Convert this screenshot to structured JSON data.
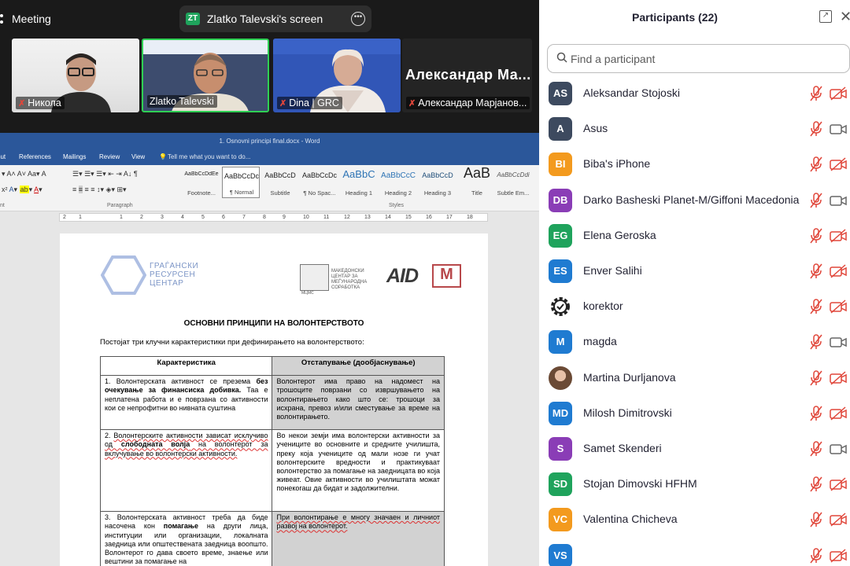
{
  "meeting": {
    "label": "Meeting"
  },
  "share": {
    "badge": "ZT",
    "title": "Zlatko Talevski's screen",
    "badge_color": "#1fa35c"
  },
  "videos": [
    {
      "name": "Никола",
      "muted": true
    },
    {
      "name": "Zlatko Talevski",
      "muted": false,
      "active_border": "#2fd054"
    },
    {
      "name": "Dina | GRC",
      "muted": true
    },
    {
      "name": "Александар Марјанов...",
      "muted": true,
      "big_label": "Александар  Ма..."
    }
  ],
  "word": {
    "title": "1. Osnovni principi final.docx - Word",
    "tabs": [
      "out",
      "References",
      "Mailings",
      "Review",
      "View"
    ],
    "tell_me": "Tell me what you want to do...",
    "styles": [
      {
        "sample": "AaBbCcDdEe",
        "name": "Footnote..."
      },
      {
        "sample": "AaBbCcDc",
        "name": "¶ Normal"
      },
      {
        "sample": "AaBbCcD",
        "name": "Subtitle"
      },
      {
        "sample": "AaBbCcDc",
        "name": "¶ No Spac..."
      },
      {
        "sample": "AaBbC",
        "name": "Heading 1"
      },
      {
        "sample": "AaBbCcC",
        "name": "Heading 2"
      },
      {
        "sample": "AaBbCcD",
        "name": "Heading 3"
      },
      {
        "sample": "AaB",
        "name": "Title"
      },
      {
        "sample": "AaBbCcDdi",
        "name": "Subtle Em..."
      }
    ],
    "group_labels": {
      "font": "nt",
      "paragraph": "Paragraph",
      "styles": "Styles"
    },
    "ruler": [
      "2",
      "1",
      "1",
      "2",
      "3",
      "4",
      "5",
      "6",
      "7",
      "8",
      "9",
      "10",
      "11",
      "12",
      "13",
      "14",
      "15",
      "16",
      "17",
      "18"
    ],
    "accent": "#2b579a"
  },
  "doc": {
    "org_lines": [
      "ГРАЃАНСКИ",
      "РЕСУРСЕН",
      "ЦЕНТАР"
    ],
    "mcms_lines": [
      "МАКЕДОНСКИ",
      "ЦЕНТАР ЗА",
      "МЕЃУНАРОДНА",
      "СОРАБОТКА"
    ],
    "mcms_sub": "МЦМС",
    "aid_logo": "AID",
    "lpus_logo": "M",
    "title": "ОСНОВНИ ПРИНЦИПИ НА ВОЛОНТЕРСТВОТО",
    "intro": "Постојат три клучни карактеристики при дефинирањето на волонтерството:",
    "col1": "Карактеристика",
    "col2": "Отстапување (дообјаснување)",
    "r1c1_a": "1.  Волонтерската активност се презема ",
    "r1c1_b": "без очекување за финансиска добивка.",
    "r1c1_c": " Таа е неплатена работа и е поврзана со активности кои се непрофитни во нивната суштина",
    "r1c2": "Волонтерот има право на надомест на трошоците поврзани со извршувањето на волонтирањето како што се: трошоци за исхрана, превоз и/или сместување за време на волонтирањето.",
    "r2c1_a": "2. ",
    "r2c1_b": "Волонтерските активности зависат исклучиво од ",
    "r2c1_c": "слободната волја",
    "r2c1_d": " на волонтерот за вклучување во волонтерски активности.",
    "r2c2": "Во некои земји има волонтерски активности за учениците во основните и средните училишта, преку која учениците од мали нозе ги учат волонтерските вредности и практикуваат волонтерство за помагање на заедницата во која живеат. Овие активности во училиштата можат понекогаш да бидат и задолжителни.",
    "r3c1_a": "3.  Волонтерската активност треба да биде насочена кон ",
    "r3c1_b": "помагање",
    "r3c1_c": " на други лица, институции или организации, локалната заедница или општествената заедница воопшто. Волонтерот го дава своето време, знаење или вештини за помагање на",
    "r3c2": "При волонтирање е многу значаен и личниот развој на волонтерот."
  },
  "panel": {
    "title": "Participants (22)",
    "search_placeholder": "Find a participant",
    "participants": [
      {
        "initials": "AS",
        "name": "Aleksandar Stojoski",
        "color": "#3d4a5f",
        "cam_off": true
      },
      {
        "initials": "A",
        "name": "Asus",
        "color": "#3d4a5f",
        "cam_off": false
      },
      {
        "initials": "BI",
        "name": "Biba's iPhone",
        "color": "#f39a1e",
        "cam_off": true
      },
      {
        "initials": "DB",
        "name": "Darko Basheski Planet-M/Giffoni Macedonia",
        "color": "#8a3db6",
        "cam_off": false
      },
      {
        "initials": "EG",
        "name": "Elena Geroska",
        "color": "#1fa35c",
        "cam_off": true
      },
      {
        "initials": "ES",
        "name": "Enver Salihi",
        "color": "#1f7bd1",
        "cam_off": true
      },
      {
        "initials": "",
        "name": "korektor",
        "color": "#ffffff",
        "icon": "gear-check-icon",
        "cam_off": true
      },
      {
        "initials": "M",
        "name": "magda",
        "color": "#1f7bd1",
        "cam_off": false
      },
      {
        "initials": "",
        "name": "Martina Durljanova",
        "color": "#b08a6a",
        "icon": "photo",
        "cam_off": true
      },
      {
        "initials": "MD",
        "name": "Milosh Dimitrovski",
        "color": "#1f7bd1",
        "cam_off": true
      },
      {
        "initials": "S",
        "name": "Samet Skenderi",
        "color": "#8a3db6",
        "cam_off": false
      },
      {
        "initials": "SD",
        "name": "Stojan Dimovski HFHM",
        "color": "#1fa35c",
        "cam_off": true
      },
      {
        "initials": "VC",
        "name": "Valentina Chicheva",
        "color": "#f39a1e",
        "cam_off": true
      },
      {
        "initials": "VS",
        "name": "",
        "color": "#1f7bd1",
        "cam_off": true
      }
    ]
  }
}
